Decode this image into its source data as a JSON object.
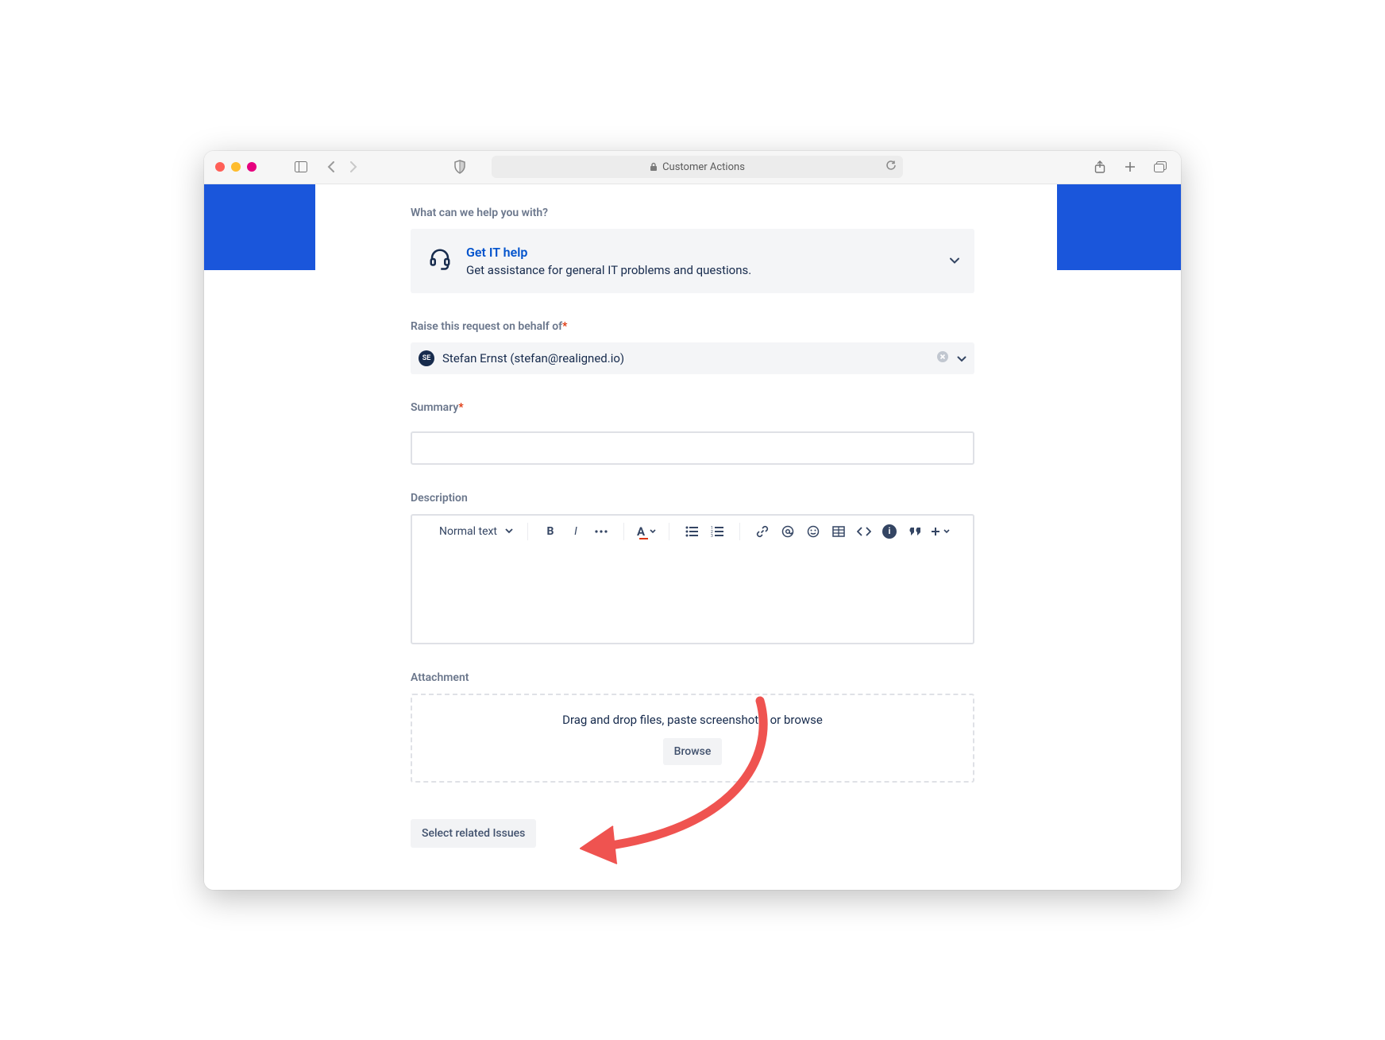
{
  "browser": {
    "address_title": "Customer Actions"
  },
  "form": {
    "help_label": "What can we help you with?",
    "request_type": {
      "title": "Get IT help",
      "description": "Get assistance for general IT problems and questions."
    },
    "behalf_label": "Raise this request on behalf of",
    "user": {
      "initials": "SE",
      "display": "Stefan Ernst (stefan@realigned.io)"
    },
    "summary_label": "Summary",
    "summary_value": "",
    "description_label": "Description",
    "toolbar": {
      "text_style": "Normal text"
    },
    "attachment_label": "Attachment",
    "attachment_hint": "Drag and drop files, paste screenshots, or browse",
    "browse_label": "Browse",
    "related_label": "Select related Issues"
  }
}
